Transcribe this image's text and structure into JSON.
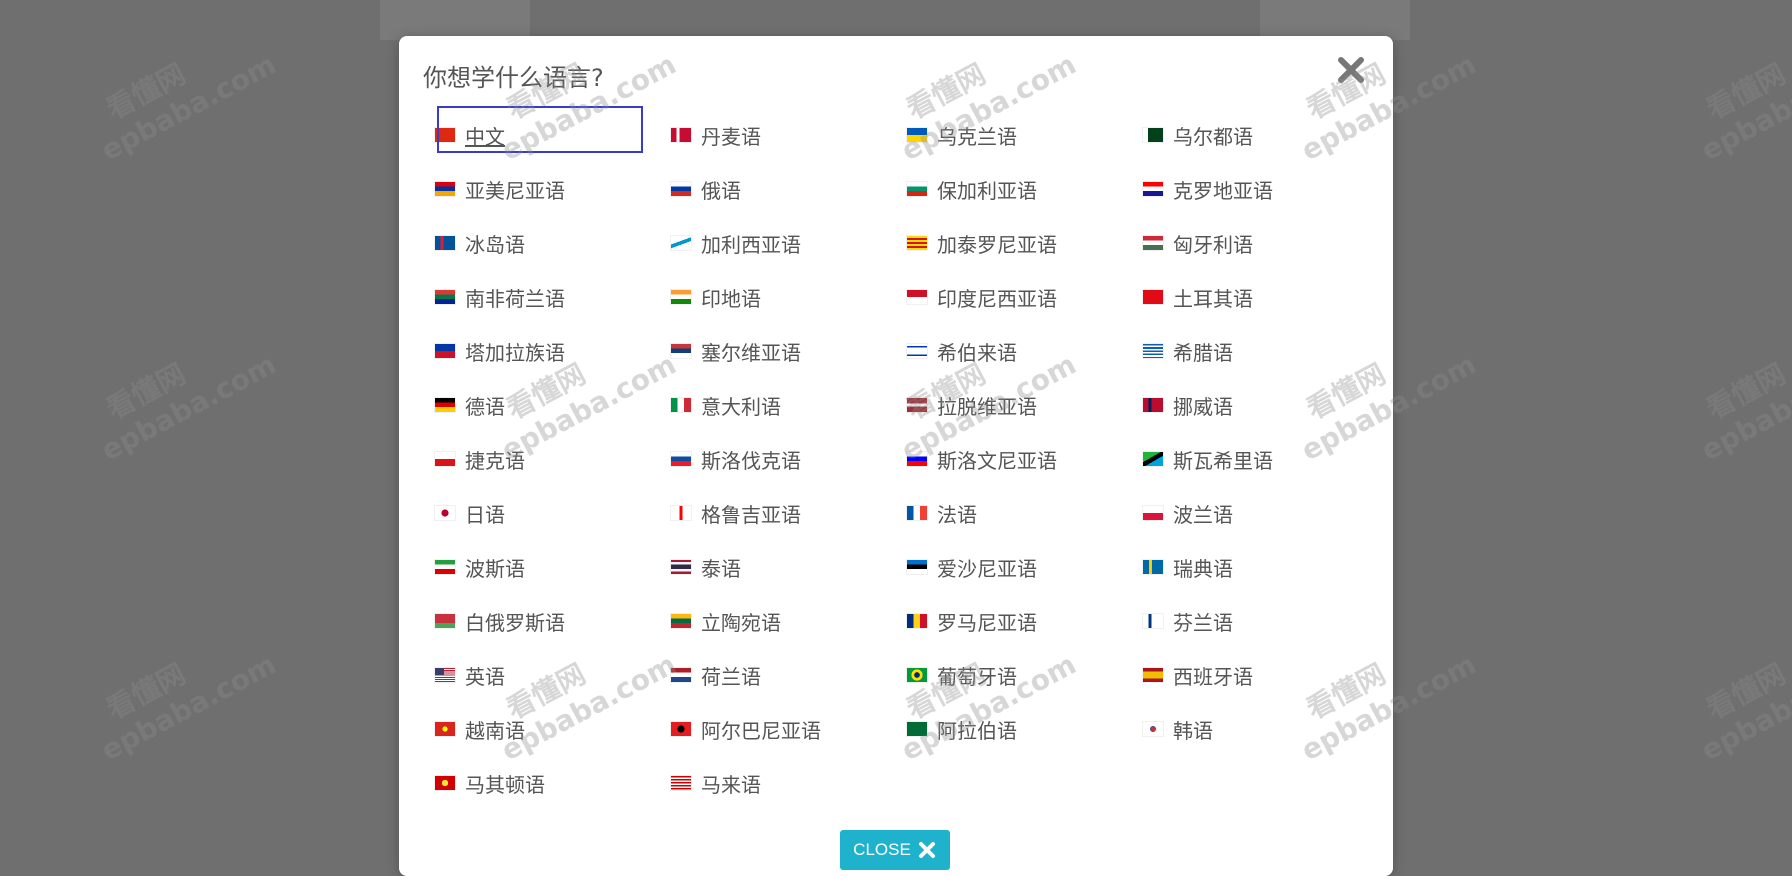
{
  "dialog": {
    "title": "你想学什么语言?",
    "close_label": "CLOSE",
    "accent_color": "#1fb2cc",
    "selected_language": "中文"
  },
  "watermark": {
    "line1": "看懂网",
    "line2": "epbaba.com"
  },
  "languages": [
    {
      "label": "中文",
      "flag": "cn"
    },
    {
      "label": "丹麦语",
      "flag": "dk"
    },
    {
      "label": "乌克兰语",
      "flag": "ua"
    },
    {
      "label": "乌尔都语",
      "flag": "pk"
    },
    {
      "label": "亚美尼亚语",
      "flag": "am"
    },
    {
      "label": "俄语",
      "flag": "ru"
    },
    {
      "label": "保加利亚语",
      "flag": "bg"
    },
    {
      "label": "克罗地亚语",
      "flag": "hr"
    },
    {
      "label": "冰岛语",
      "flag": "is"
    },
    {
      "label": "加利西亚语",
      "flag": "gl"
    },
    {
      "label": "加泰罗尼亚语",
      "flag": "ca"
    },
    {
      "label": "匈牙利语",
      "flag": "hu"
    },
    {
      "label": "南非荷兰语",
      "flag": "za"
    },
    {
      "label": "印地语",
      "flag": "in"
    },
    {
      "label": "印度尼西亚语",
      "flag": "id"
    },
    {
      "label": "土耳其语",
      "flag": "tr"
    },
    {
      "label": "塔加拉族语",
      "flag": "ph"
    },
    {
      "label": "塞尔维亚语",
      "flag": "rs"
    },
    {
      "label": "希伯来语",
      "flag": "il"
    },
    {
      "label": "希腊语",
      "flag": "gr"
    },
    {
      "label": "德语",
      "flag": "de"
    },
    {
      "label": "意大利语",
      "flag": "it"
    },
    {
      "label": "拉脱维亚语",
      "flag": "lv"
    },
    {
      "label": "挪威语",
      "flag": "no"
    },
    {
      "label": "捷克语",
      "flag": "cz"
    },
    {
      "label": "斯洛伐克语",
      "flag": "sk"
    },
    {
      "label": "斯洛文尼亚语",
      "flag": "si"
    },
    {
      "label": "斯瓦希里语",
      "flag": "tz"
    },
    {
      "label": "日语",
      "flag": "jp"
    },
    {
      "label": "格鲁吉亚语",
      "flag": "ge"
    },
    {
      "label": "法语",
      "flag": "fr"
    },
    {
      "label": "波兰语",
      "flag": "pl"
    },
    {
      "label": "波斯语",
      "flag": "ir"
    },
    {
      "label": "泰语",
      "flag": "th"
    },
    {
      "label": "爱沙尼亚语",
      "flag": "ee"
    },
    {
      "label": "瑞典语",
      "flag": "se"
    },
    {
      "label": "白俄罗斯语",
      "flag": "by"
    },
    {
      "label": "立陶宛语",
      "flag": "lt"
    },
    {
      "label": "罗马尼亚语",
      "flag": "ro"
    },
    {
      "label": "芬兰语",
      "flag": "fi"
    },
    {
      "label": "英语",
      "flag": "us"
    },
    {
      "label": "荷兰语",
      "flag": "nl"
    },
    {
      "label": "葡萄牙语",
      "flag": "br"
    },
    {
      "label": "西班牙语",
      "flag": "es"
    },
    {
      "label": "越南语",
      "flag": "vn"
    },
    {
      "label": "阿尔巴尼亚语",
      "flag": "al"
    },
    {
      "label": "阿拉伯语",
      "flag": "sa"
    },
    {
      "label": "韩语",
      "flag": "kr"
    },
    {
      "label": "马其顿语",
      "flag": "mk"
    },
    {
      "label": "马来语",
      "flag": "my"
    }
  ]
}
